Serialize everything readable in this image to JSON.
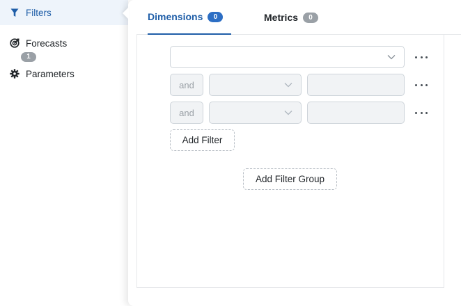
{
  "sidebar": {
    "items": [
      {
        "label": "Filters",
        "icon": "filter-icon",
        "active": true
      },
      {
        "label": "Forecasts",
        "icon": "target-icon",
        "active": false
      },
      {
        "label": "Parameters",
        "icon": "gear-icon",
        "active": false
      }
    ]
  },
  "tabs": [
    {
      "label": "Dimensions",
      "count": "0",
      "active": true
    },
    {
      "label": "Metrics",
      "count": "0",
      "active": false
    }
  ],
  "filter_group": {
    "number": "1",
    "main_select_value": "",
    "rows": [
      {
        "connector": "and",
        "field_value": "",
        "value": ""
      },
      {
        "connector": "and",
        "field_value": "",
        "value": ""
      }
    ]
  },
  "buttons": {
    "add_filter": "Add Filter",
    "add_filter_group": "Add Filter Group"
  },
  "colors": {
    "accent": "#1f5ea8",
    "badge_active": "#2c6ec4",
    "badge_inactive": "#9aa0a6",
    "active_row_bg": "#eef4fb"
  }
}
